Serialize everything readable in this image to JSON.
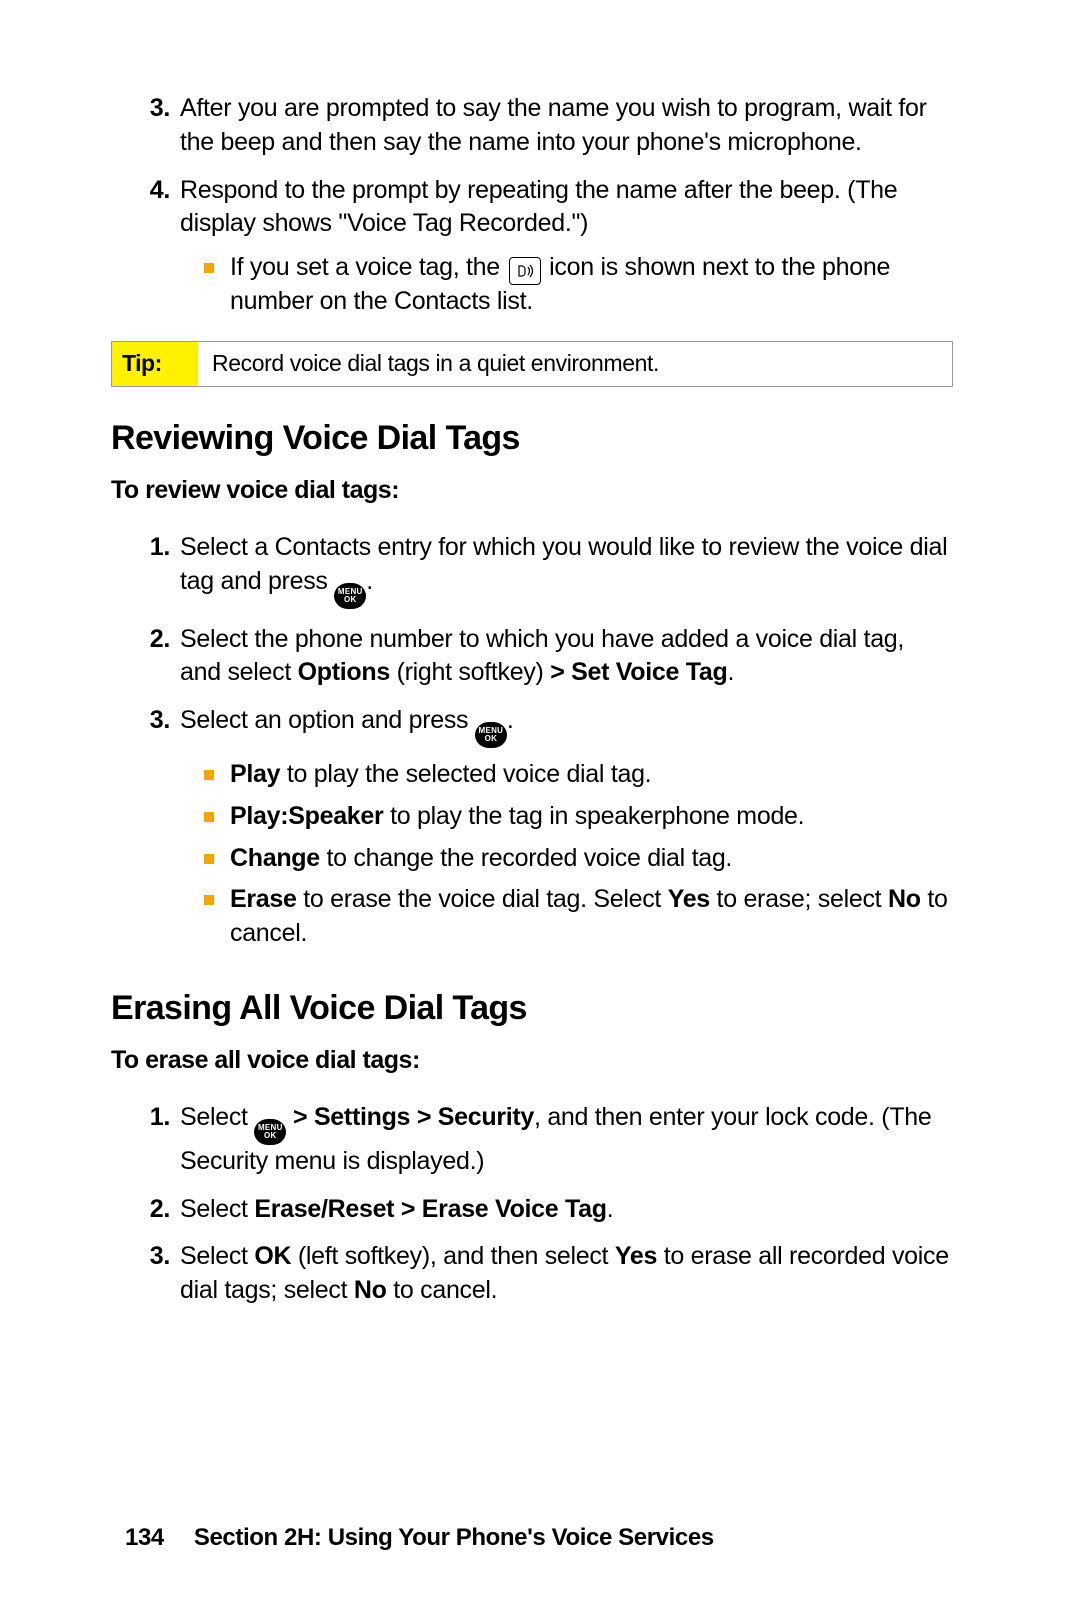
{
  "top_steps": {
    "step3": {
      "num": "3.",
      "text": "After you are prompted to say the name you wish to program, wait for the beep and then say the name into your phone's microphone."
    },
    "step4": {
      "num": "4.",
      "text": "Respond to the prompt by repeating the name after the beep. (The display shows \"Voice Tag Recorded.\")",
      "sub_a_before": "If you set a voice tag, the ",
      "sub_a_after": " icon is shown next to the phone number on the Contacts list."
    }
  },
  "tip": {
    "label": "Tip:",
    "text": "Record voice dial tags in a quiet environment."
  },
  "reviewing": {
    "heading": "Reviewing Voice Dial Tags",
    "lead": "To review voice dial tags:",
    "step1": {
      "num": "1.",
      "before": "Select a Contacts entry for which you would like to review the voice dial tag and press ",
      "after": "."
    },
    "step2": {
      "num": "2.",
      "pre": "Select the phone number to which you have added a voice dial tag, and select ",
      "options": "Options",
      "mid": " (right softkey)",
      "gt": " > ",
      "setvoicetag": "Set Voice Tag",
      "end": "."
    },
    "step3": {
      "num": "3.",
      "before": "Select an option and press ",
      "after": ".",
      "play_b": "Play",
      "play_t": " to play the selected voice dial tag.",
      "playsp_b": "Play:Speaker",
      "playsp_t": " to play the tag in speakerphone mode.",
      "change_b": "Change",
      "change_t": " to change the recorded voice dial tag.",
      "erase_b": "Erase",
      "erase_mid": " to erase the voice dial tag. Select ",
      "erase_yes": "Yes",
      "erase_mid2": " to erase; select ",
      "erase_no": "No",
      "erase_end": " to cancel."
    }
  },
  "erasing": {
    "heading": "Erasing All Voice Dial Tags",
    "lead": "To erase all voice dial tags:",
    "step1": {
      "num": "1.",
      "before": "Select ",
      "gt1": " > ",
      "settings": "Settings",
      "gt2": " > ",
      "security": "Security",
      "after": ", and then enter your lock code. (The Security menu is displayed.)"
    },
    "step2": {
      "num": "2.",
      "pre": "Select ",
      "path": "Erase/Reset > Erase Voice Tag",
      "end": "."
    },
    "step3": {
      "num": "3.",
      "pre": "Select ",
      "ok": "OK",
      "mid1": " (left softkey), and then select ",
      "yes": "Yes",
      "mid2": " to erase all recorded voice dial tags; select ",
      "no": "No",
      "end": " to cancel."
    }
  },
  "footer": {
    "page": "134",
    "section": "Section 2H: Using Your Phone's Voice Services"
  },
  "icons": {
    "menu": "MENU",
    "ok": "OK"
  }
}
